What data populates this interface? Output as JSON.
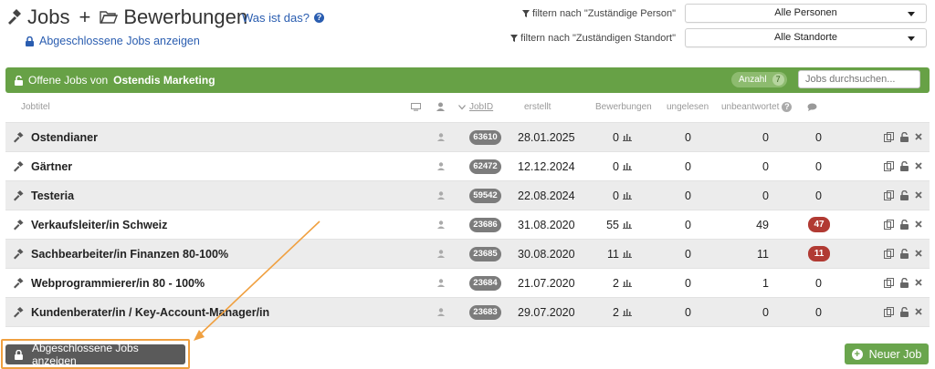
{
  "header": {
    "title_jobs": "Jobs",
    "title_plus": "+",
    "title_applications": "Bewerbungen",
    "help_link": "Was ist das?",
    "show_closed_link": "Abgeschlossene Jobs anzeigen"
  },
  "filters": {
    "person_label": "filtern nach \"Zuständige Person\"",
    "person_value": "Alle Personen",
    "location_label": "filtern nach \"Zuständigen Standort\"",
    "location_value": "Alle Standorte"
  },
  "banner": {
    "prefix": "Offene Jobs von",
    "company": "Ostendis Marketing",
    "count_label": "Anzahl",
    "count": "7",
    "search_placeholder": "Jobs durchsuchen..."
  },
  "columns": {
    "jobtitle": "Jobtitel",
    "jobid": "JobID",
    "created": "erstellt",
    "applications": "Bewerbungen",
    "unread": "ungelesen",
    "unanswered": "unbeantwortet"
  },
  "jobs": [
    {
      "title": "Ostendianer",
      "id": "63610",
      "created": "28.01.2025",
      "applications": "0",
      "unread": "0",
      "unanswered": "0",
      "messages": "0",
      "messages_alert": false
    },
    {
      "title": "Gärtner",
      "id": "62472",
      "created": "12.12.2024",
      "applications": "0",
      "unread": "0",
      "unanswered": "0",
      "messages": "0",
      "messages_alert": false
    },
    {
      "title": "Testeria",
      "id": "59542",
      "created": "22.08.2024",
      "applications": "0",
      "unread": "0",
      "unanswered": "0",
      "messages": "0",
      "messages_alert": false
    },
    {
      "title": "Verkaufsleiter/in Schweiz",
      "id": "23686",
      "created": "31.08.2020",
      "applications": "55",
      "unread": "0",
      "unanswered": "49",
      "messages": "47",
      "messages_alert": true
    },
    {
      "title": "Sachbearbeiter/in Finanzen 80-100%",
      "id": "23685",
      "created": "30.08.2020",
      "applications": "11",
      "unread": "0",
      "unanswered": "11",
      "messages": "11",
      "messages_alert": true
    },
    {
      "title": "Webprogrammierer/in 80 - 100%",
      "id": "23684",
      "created": "21.07.2020",
      "applications": "2",
      "unread": "0",
      "unanswered": "1",
      "messages": "0",
      "messages_alert": false
    },
    {
      "title": "Kundenberater/in / Key-Account-Manager/in",
      "id": "23683",
      "created": "29.07.2020",
      "applications": "2",
      "unread": "0",
      "unanswered": "0",
      "messages": "0",
      "messages_alert": false
    }
  ],
  "footer": {
    "show_closed_button": "Abgeschlossene Jobs anzeigen",
    "new_job_button": "Neuer Job"
  },
  "colors": {
    "banner_green": "#67a146",
    "link_blue": "#2a5db0",
    "alert_red": "#b13a33",
    "highlight_orange": "#f0a040"
  }
}
